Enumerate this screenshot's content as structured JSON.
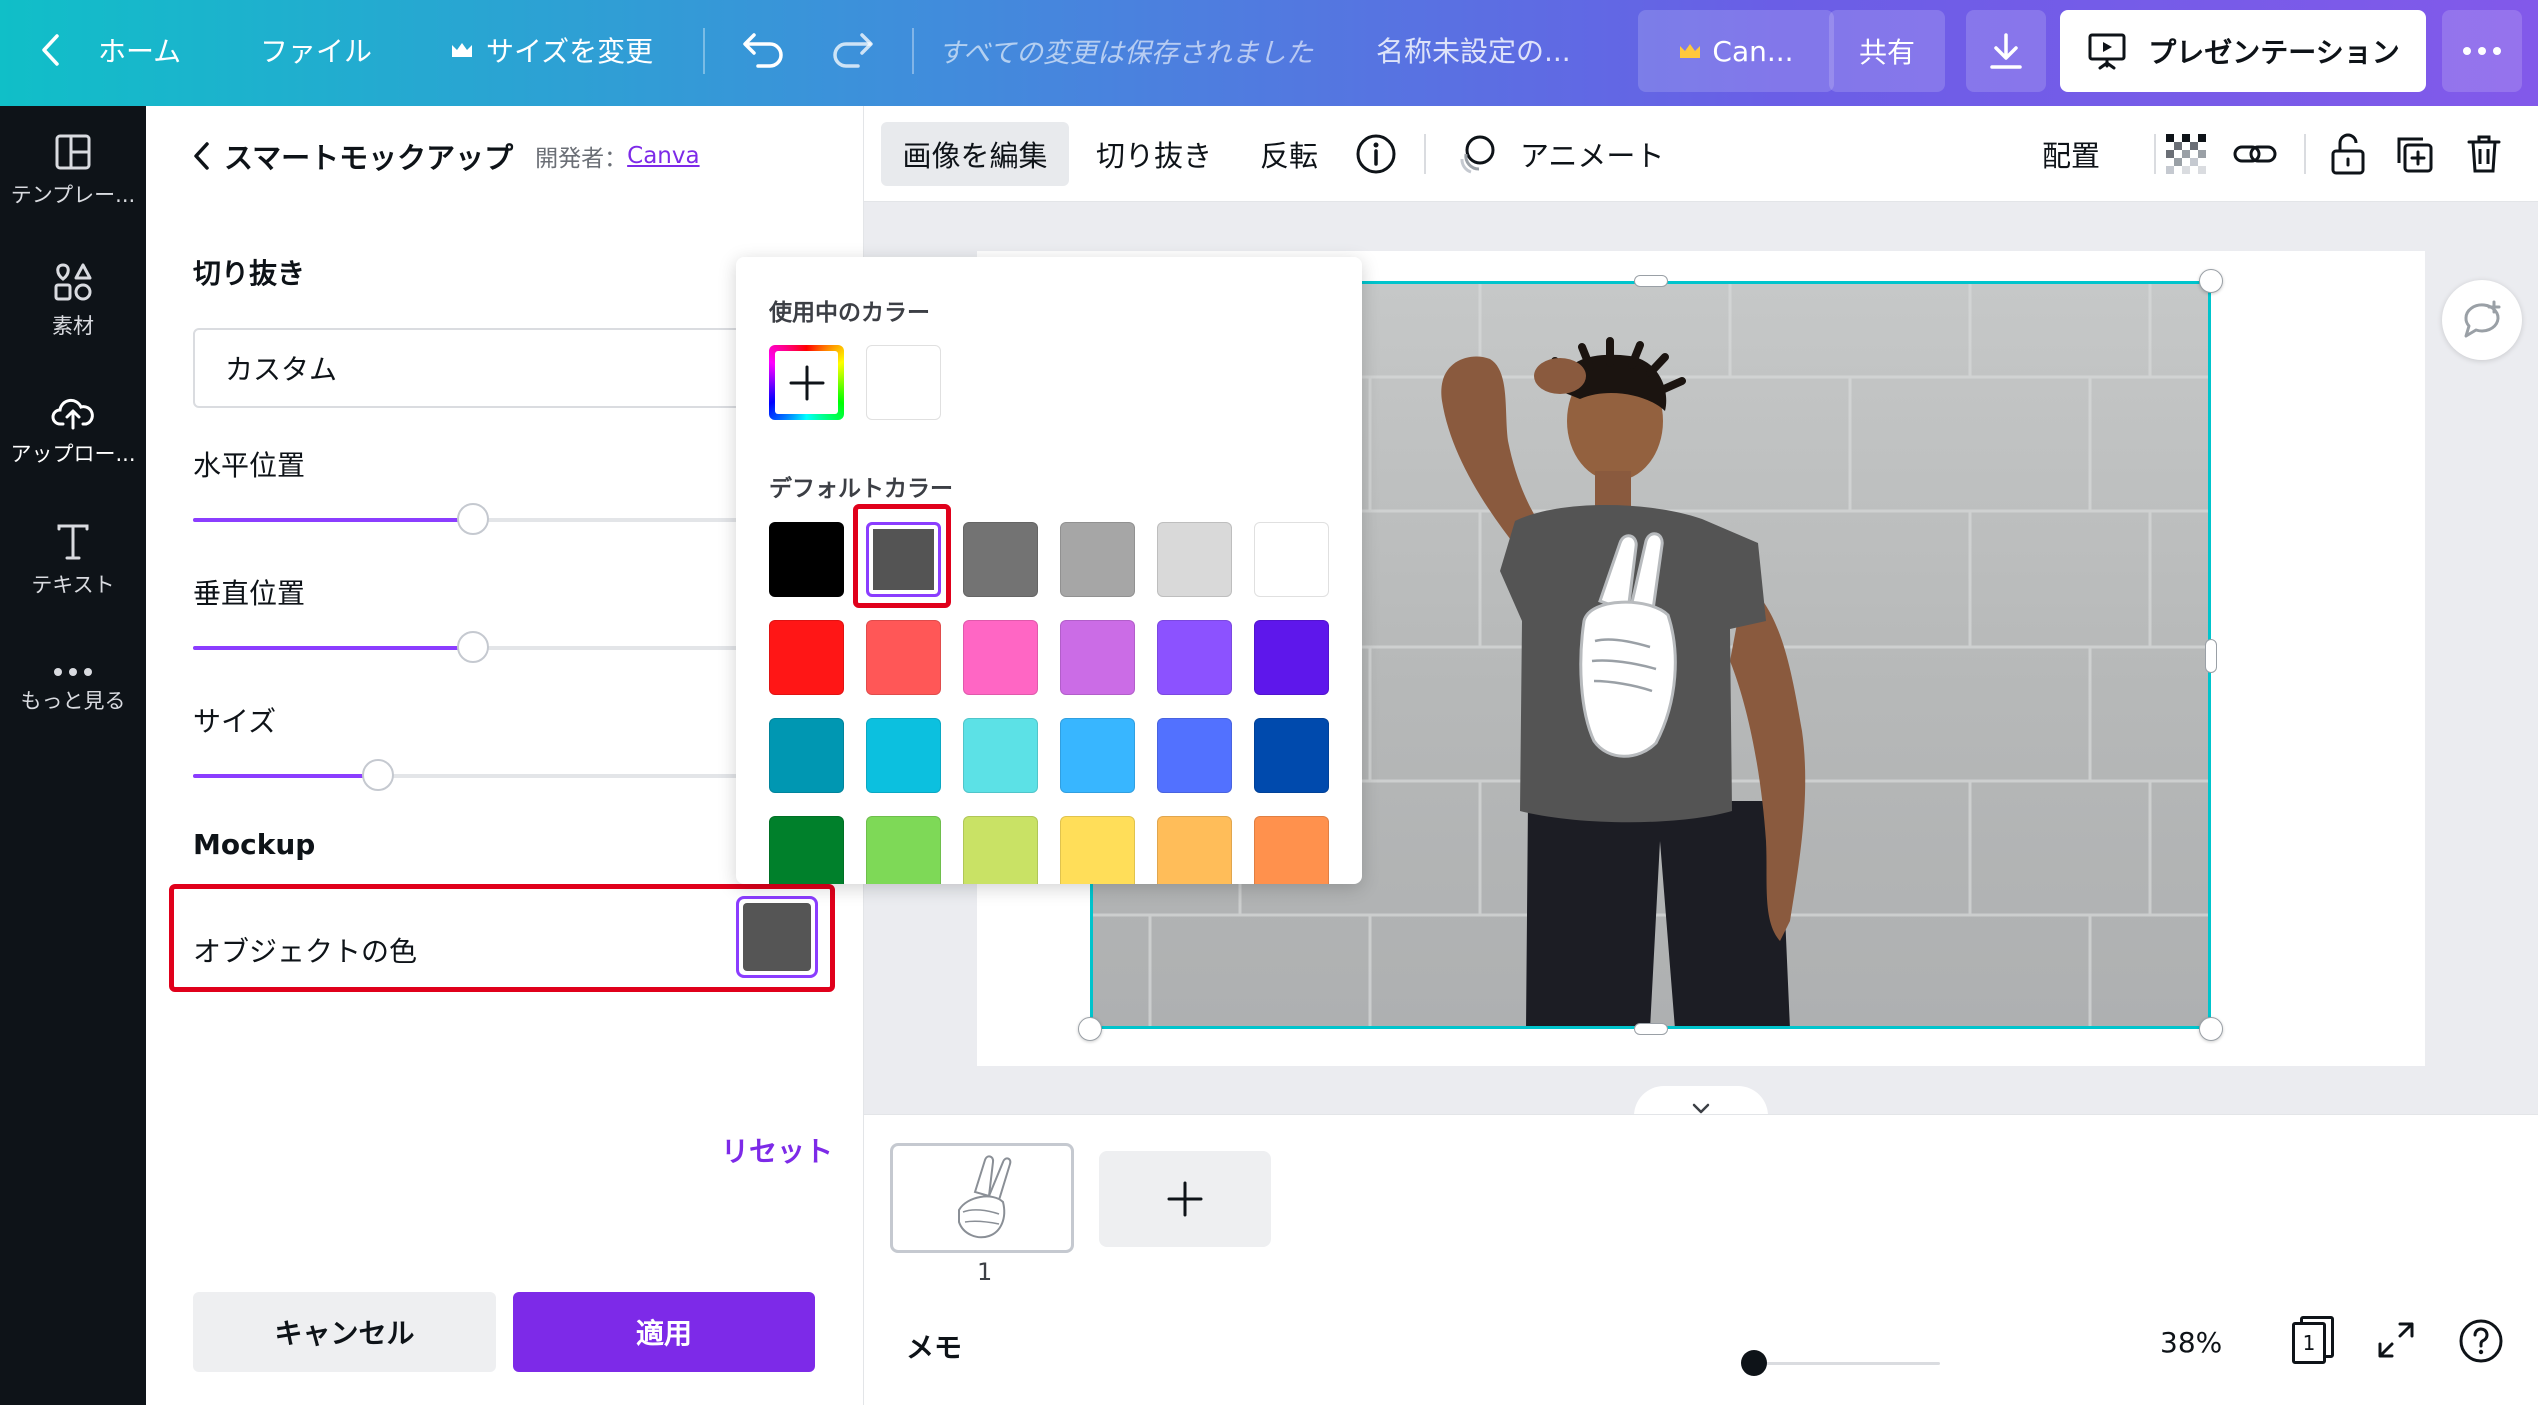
{
  "topbar": {
    "home": "ホーム",
    "file": "ファイル",
    "resize": "サイズを変更",
    "save_status": "すべての変更は保存されました",
    "doc_title": "名称未設定の...",
    "canva_pro": "Can...",
    "share": "共有",
    "present": "プレゼンテーション"
  },
  "rail": {
    "templates": "テンプレー...",
    "elements": "素材",
    "uploads": "アップロー...",
    "text": "テキスト",
    "more": "もっと見る"
  },
  "panel": {
    "back_title": "スマートモックアップ",
    "developer_label": "開発者：",
    "developer_link": "Canva",
    "crop_title": "切り抜き",
    "crop_value": "カスタム",
    "horizontal_label": "水平位置",
    "horizontal_value": 0.5,
    "vertical_label": "垂直位置",
    "vertical_value": 0.5,
    "size_label": "サイズ",
    "size_value": 0.33,
    "mockup_title": "Mockup",
    "object_color_label": "オブジェクトの色",
    "object_color": "#555555",
    "reset": "リセット",
    "cancel": "キャンセル",
    "apply": "適用"
  },
  "color_popup": {
    "in_use_title": "使用中のカラー",
    "default_title": "デフォルトカラー",
    "in_use_colors": [
      "#ffffff"
    ],
    "default_colors": [
      "#000000",
      "#545454",
      "#737373",
      "#a6a6a6",
      "#d9d9d9",
      "#ffffff",
      "#ff1616",
      "#ff5757",
      "#ff66c4",
      "#cb6ce6",
      "#8c52ff",
      "#5e17eb",
      "#0097b2",
      "#0cc0df",
      "#5ce1e6",
      "#38b6ff",
      "#5271ff",
      "#004aad",
      "#00802b",
      "#7ed957",
      "#c9e265",
      "#ffde59",
      "#ffbd59",
      "#ff914d"
    ],
    "selected_color": "#545454"
  },
  "toolbar": {
    "edit_image": "画像を編集",
    "crop": "切り抜き",
    "flip": "反転",
    "animate": "アニメート",
    "position": "配置"
  },
  "pages": {
    "page_number": "1"
  },
  "footer": {
    "notes": "メモ",
    "zoom": "38%",
    "page_count": "1",
    "zoom_value": 0.05
  },
  "colors": {
    "accent": "#8b3dff",
    "highlight": "#e0001b",
    "selection": "#00c4cc"
  }
}
